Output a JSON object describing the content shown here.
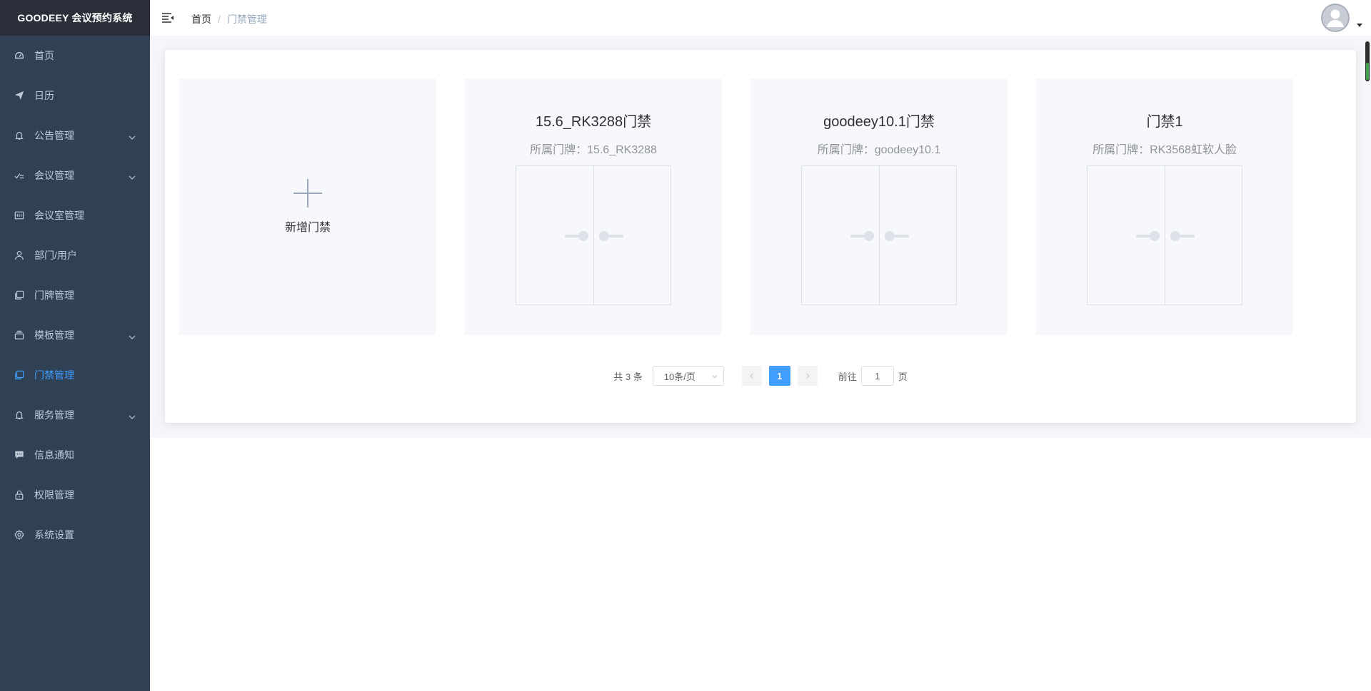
{
  "app": {
    "title": "GOODEEY 会议预约系统"
  },
  "sidebar": {
    "items": [
      {
        "label": "首页",
        "icon": "dashboard-icon",
        "expandable": false,
        "active": false
      },
      {
        "label": "日历",
        "icon": "send-icon",
        "expandable": false,
        "active": false
      },
      {
        "label": "公告管理",
        "icon": "bell-icon",
        "expandable": true,
        "active": false
      },
      {
        "label": "会议管理",
        "icon": "checklist-icon",
        "expandable": true,
        "active": false
      },
      {
        "label": "会议室管理",
        "icon": "board-icon",
        "expandable": false,
        "active": false
      },
      {
        "label": "部门/用户",
        "icon": "user-icon",
        "expandable": false,
        "active": false
      },
      {
        "label": "门牌管理",
        "icon": "copy-icon",
        "expandable": false,
        "active": false
      },
      {
        "label": "模板管理",
        "icon": "layers-icon",
        "expandable": true,
        "active": false
      },
      {
        "label": "门禁管理",
        "icon": "copy-icon",
        "expandable": false,
        "active": true
      },
      {
        "label": "服务管理",
        "icon": "bell-icon",
        "expandable": true,
        "active": false
      },
      {
        "label": "信息通知",
        "icon": "message-icon",
        "expandable": false,
        "active": false
      },
      {
        "label": "权限管理",
        "icon": "lock-icon",
        "expandable": false,
        "active": false
      },
      {
        "label": "系统设置",
        "icon": "gear-icon",
        "expandable": false,
        "active": false
      }
    ]
  },
  "header": {
    "breadcrumb": {
      "home": "首页",
      "separator": "/",
      "current": "门禁管理"
    }
  },
  "main": {
    "add_card": {
      "label": "新增门禁"
    },
    "cards": [
      {
        "title": "15.6_RK3288门禁",
        "subtitle": "所属门牌：15.6_RK3288"
      },
      {
        "title": "goodeey10.1门禁",
        "subtitle": "所属门牌：goodeey10.1"
      },
      {
        "title": "门禁1",
        "subtitle": "所属门牌：RK3568虹软人脸"
      }
    ]
  },
  "pagination": {
    "total": "共 3 条",
    "page_size": "10条/页",
    "current_page": "1",
    "goto_prefix": "前往",
    "goto_value": "1",
    "goto_suffix": "页"
  },
  "colors": {
    "sidebar_bg": "#304156",
    "brand_bg": "#2b2f3a",
    "accent": "#409eff",
    "menu_text": "#bfcbd9",
    "card_bg": "#f7f8fc"
  }
}
